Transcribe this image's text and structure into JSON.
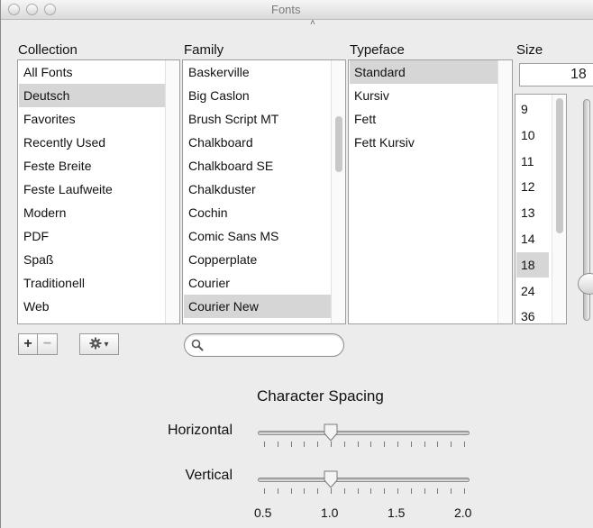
{
  "window": {
    "title": "Fonts"
  },
  "columns": {
    "collection": "Collection",
    "family": "Family",
    "typeface": "Typeface",
    "size": "Size"
  },
  "collection": {
    "items": [
      "All Fonts",
      "Deutsch",
      "Favorites",
      "Recently Used",
      "Feste Breite",
      "Feste Laufweite",
      "Modern",
      "PDF",
      "Spaß",
      "Traditionell",
      "Web"
    ],
    "selected": "Deutsch"
  },
  "family": {
    "items": [
      "Baskerville",
      "Big Caslon",
      "Brush Script MT",
      "Chalkboard",
      "Chalkboard SE",
      "Chalkduster",
      "Cochin",
      "Comic Sans MS",
      "Copperplate",
      "Courier",
      "Courier New"
    ],
    "selected": "Courier New"
  },
  "typeface": {
    "items": [
      "Standard",
      "Kursiv",
      "Fett",
      "Fett Kursiv"
    ],
    "selected": "Standard"
  },
  "size": {
    "value": "18",
    "items": [
      "9",
      "10",
      "11",
      "12",
      "13",
      "14",
      "18",
      "24",
      "36"
    ],
    "selected": "18"
  },
  "buttons": {
    "add": "+",
    "remove": "−",
    "gear_caret": "▾"
  },
  "search": {
    "value": "",
    "placeholder": ""
  },
  "spacing": {
    "title": "Character Spacing",
    "horizontal_label": "Horizontal",
    "vertical_label": "Vertical",
    "horizontal_value": 1.0,
    "vertical_value": 1.0,
    "range": [
      0.5,
      2.0
    ],
    "tick_labels": [
      "0.5",
      "1.0",
      "1.5",
      "2.0"
    ]
  },
  "colors": {
    "selection": "#d6d6d6",
    "background": "#ececec"
  }
}
